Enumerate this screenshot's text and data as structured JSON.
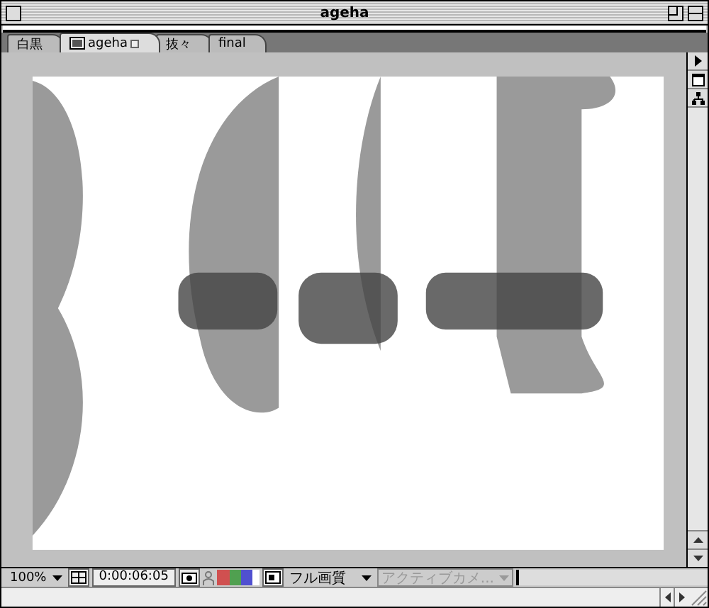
{
  "window": {
    "title": "ageha"
  },
  "tabs": [
    {
      "label": "白黒",
      "selected": false,
      "icon": false
    },
    {
      "label": "ageha",
      "selected": true,
      "icon": true
    },
    {
      "label": "抜々",
      "selected": false,
      "icon": false
    },
    {
      "label": "final",
      "selected": false,
      "icon": false
    }
  ],
  "status_bar": {
    "zoom": "100%",
    "timecode": "0:00:06:05",
    "resolution": "フル画質",
    "camera": {
      "label": "アクティブカメ...",
      "disabled": true
    }
  }
}
